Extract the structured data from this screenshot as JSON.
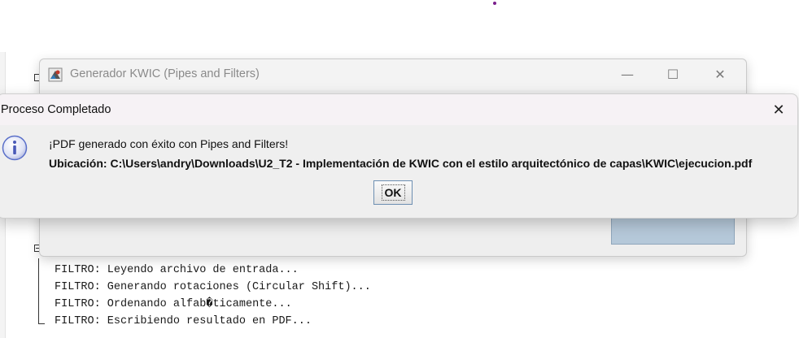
{
  "back_window": {
    "title": "Generador KWIC (Pipes and Filters)",
    "minimize_glyph": "—",
    "maximize_glyph": "☐",
    "close_glyph": "✕"
  },
  "console": {
    "lines": [
      "FILTRO: Leyendo archivo de entrada...",
      "FILTRO: Generando rotaciones (Circular Shift)...",
      "FILTRO: Ordenando alfab�ticamente...",
      "FILTRO: Escribiendo resultado en PDF..."
    ]
  },
  "dialog": {
    "title": "Proceso Completado",
    "close_glyph": "✕",
    "message_line1": "¡PDF generado con éxito con Pipes and Filters!",
    "message_line2": "Ubicación: C:\\Users\\andry\\Downloads\\U2_T2 - Implementación de KWIC con el estilo arquitectónico de capas\\KWIC\\ejecucion.pdf",
    "ok_label": "OK",
    "icon": "info-icon"
  },
  "colors": {
    "accent_blue": "#b5c8d9",
    "info_icon": "#5a6fc9",
    "dot": "#7a1f8c"
  }
}
